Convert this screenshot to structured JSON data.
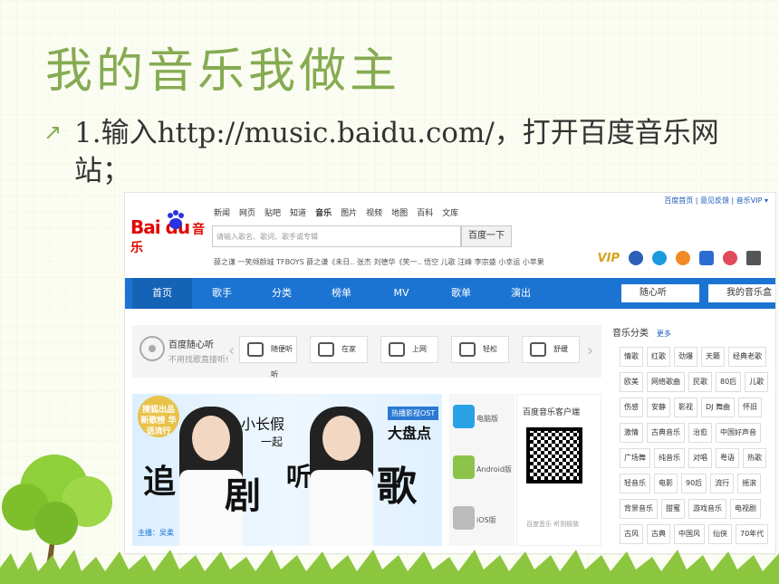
{
  "slide": {
    "title": "我的音乐我做主",
    "bullet_icon": "flower-arrow-icon",
    "bullet_text": "1.输入http://music.baidu.com/，打开百度音乐网站；"
  },
  "shot": {
    "top_links": "百度首页 | 意见反馈 | 音乐VIP ▾",
    "logo": {
      "text": "Bai du",
      "sub": "音乐"
    },
    "nav_links": [
      "新闻",
      "网页",
      "贴吧",
      "知道",
      "音乐",
      "图片",
      "视频",
      "地图",
      "百科",
      "文库"
    ],
    "search": {
      "placeholder": "请输入歌名、歌词、歌手或专辑",
      "button": "百度一下"
    },
    "hot_line": "薛之谦 一笑倾颜城  TFBOYS  薛之谦《未日..  张杰  刘德华《笑一..  悟空  儿歌  汪峰  李宗盛  小幸运  小苹果",
    "vip_tag": "VIP",
    "main_nav": [
      "首页",
      "歌手",
      "分类",
      "榜单",
      "MV",
      "歌单",
      "演出"
    ],
    "nav_right": [
      "随心听",
      "我的音乐盒"
    ],
    "radio": {
      "title": "百度随心听",
      "subtitle": "不用找歌直接听!",
      "channels": [
        "随便听听",
        "在家",
        "上网",
        "轻松",
        "舒缓"
      ]
    },
    "banner": {
      "badge": "搜狐出品 新歌榜 华语流行",
      "words": [
        "小长假",
        "一起",
        "追",
        "剧",
        "听",
        "歌"
      ],
      "ost": "热播影视OST",
      "headline": "大盘点",
      "author": "主播：吴柔"
    },
    "apps": [
      "电脑版",
      "Android版",
      "iOS版"
    ],
    "client": {
      "title": "百度音乐客户端",
      "slogan": "百度音乐 听到极致"
    },
    "categories": {
      "title": "音乐分类",
      "more": "更多",
      "tags": [
        "情歌",
        "红歌",
        "劲爆",
        "天籁",
        "经典老歌",
        "欧美",
        "网络歌曲",
        "民歌",
        "80后",
        "儿歌",
        "伤感",
        "安静",
        "影视",
        "DJ 舞曲",
        "怀旧",
        "激情",
        "古典音乐",
        "治愈",
        "中国好声音",
        "广场舞",
        "纯音乐",
        "对唱",
        "粤语",
        "热歌",
        "轻音乐",
        "电影",
        "90后",
        "流行",
        "摇滚",
        "背景音乐",
        "甜蜜",
        "游戏音乐",
        "电视剧",
        "古风",
        "古典",
        "中国风",
        "仙侠",
        "70年代"
      ]
    }
  },
  "colors": {
    "title": "#86ab52",
    "nav_blue": "#1b74d2",
    "logo_red": "#e10601"
  }
}
